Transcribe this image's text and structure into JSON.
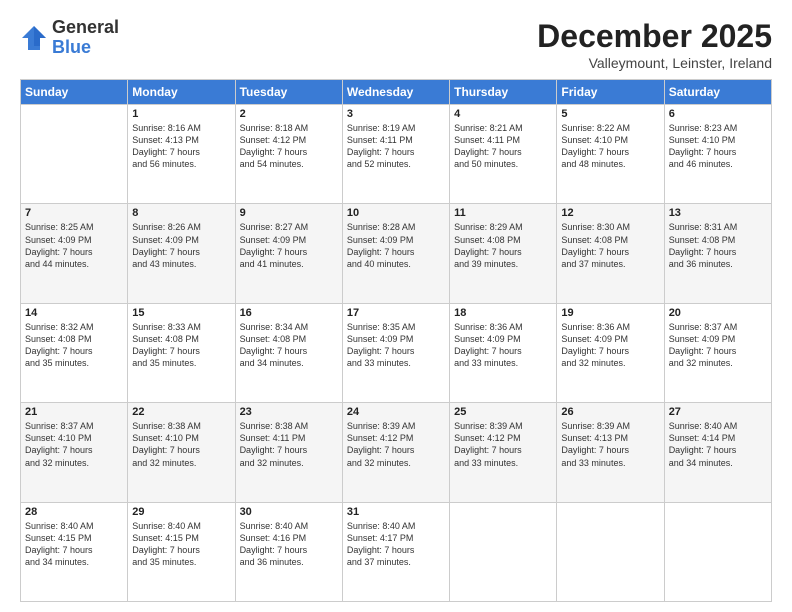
{
  "logo": {
    "general": "General",
    "blue": "Blue"
  },
  "title": {
    "month": "December 2025",
    "location": "Valleymount, Leinster, Ireland"
  },
  "headers": [
    "Sunday",
    "Monday",
    "Tuesday",
    "Wednesday",
    "Thursday",
    "Friday",
    "Saturday"
  ],
  "weeks": [
    [
      {
        "day": "",
        "info": ""
      },
      {
        "day": "1",
        "info": "Sunrise: 8:16 AM\nSunset: 4:13 PM\nDaylight: 7 hours\nand 56 minutes."
      },
      {
        "day": "2",
        "info": "Sunrise: 8:18 AM\nSunset: 4:12 PM\nDaylight: 7 hours\nand 54 minutes."
      },
      {
        "day": "3",
        "info": "Sunrise: 8:19 AM\nSunset: 4:11 PM\nDaylight: 7 hours\nand 52 minutes."
      },
      {
        "day": "4",
        "info": "Sunrise: 8:21 AM\nSunset: 4:11 PM\nDaylight: 7 hours\nand 50 minutes."
      },
      {
        "day": "5",
        "info": "Sunrise: 8:22 AM\nSunset: 4:10 PM\nDaylight: 7 hours\nand 48 minutes."
      },
      {
        "day": "6",
        "info": "Sunrise: 8:23 AM\nSunset: 4:10 PM\nDaylight: 7 hours\nand 46 minutes."
      }
    ],
    [
      {
        "day": "7",
        "info": "Sunrise: 8:25 AM\nSunset: 4:09 PM\nDaylight: 7 hours\nand 44 minutes."
      },
      {
        "day": "8",
        "info": "Sunrise: 8:26 AM\nSunset: 4:09 PM\nDaylight: 7 hours\nand 43 minutes."
      },
      {
        "day": "9",
        "info": "Sunrise: 8:27 AM\nSunset: 4:09 PM\nDaylight: 7 hours\nand 41 minutes."
      },
      {
        "day": "10",
        "info": "Sunrise: 8:28 AM\nSunset: 4:09 PM\nDaylight: 7 hours\nand 40 minutes."
      },
      {
        "day": "11",
        "info": "Sunrise: 8:29 AM\nSunset: 4:08 PM\nDaylight: 7 hours\nand 39 minutes."
      },
      {
        "day": "12",
        "info": "Sunrise: 8:30 AM\nSunset: 4:08 PM\nDaylight: 7 hours\nand 37 minutes."
      },
      {
        "day": "13",
        "info": "Sunrise: 8:31 AM\nSunset: 4:08 PM\nDaylight: 7 hours\nand 36 minutes."
      }
    ],
    [
      {
        "day": "14",
        "info": "Sunrise: 8:32 AM\nSunset: 4:08 PM\nDaylight: 7 hours\nand 35 minutes."
      },
      {
        "day": "15",
        "info": "Sunrise: 8:33 AM\nSunset: 4:08 PM\nDaylight: 7 hours\nand 35 minutes."
      },
      {
        "day": "16",
        "info": "Sunrise: 8:34 AM\nSunset: 4:08 PM\nDaylight: 7 hours\nand 34 minutes."
      },
      {
        "day": "17",
        "info": "Sunrise: 8:35 AM\nSunset: 4:09 PM\nDaylight: 7 hours\nand 33 minutes."
      },
      {
        "day": "18",
        "info": "Sunrise: 8:36 AM\nSunset: 4:09 PM\nDaylight: 7 hours\nand 33 minutes."
      },
      {
        "day": "19",
        "info": "Sunrise: 8:36 AM\nSunset: 4:09 PM\nDaylight: 7 hours\nand 32 minutes."
      },
      {
        "day": "20",
        "info": "Sunrise: 8:37 AM\nSunset: 4:09 PM\nDaylight: 7 hours\nand 32 minutes."
      }
    ],
    [
      {
        "day": "21",
        "info": "Sunrise: 8:37 AM\nSunset: 4:10 PM\nDaylight: 7 hours\nand 32 minutes."
      },
      {
        "day": "22",
        "info": "Sunrise: 8:38 AM\nSunset: 4:10 PM\nDaylight: 7 hours\nand 32 minutes."
      },
      {
        "day": "23",
        "info": "Sunrise: 8:38 AM\nSunset: 4:11 PM\nDaylight: 7 hours\nand 32 minutes."
      },
      {
        "day": "24",
        "info": "Sunrise: 8:39 AM\nSunset: 4:12 PM\nDaylight: 7 hours\nand 32 minutes."
      },
      {
        "day": "25",
        "info": "Sunrise: 8:39 AM\nSunset: 4:12 PM\nDaylight: 7 hours\nand 33 minutes."
      },
      {
        "day": "26",
        "info": "Sunrise: 8:39 AM\nSunset: 4:13 PM\nDaylight: 7 hours\nand 33 minutes."
      },
      {
        "day": "27",
        "info": "Sunrise: 8:40 AM\nSunset: 4:14 PM\nDaylight: 7 hours\nand 34 minutes."
      }
    ],
    [
      {
        "day": "28",
        "info": "Sunrise: 8:40 AM\nSunset: 4:15 PM\nDaylight: 7 hours\nand 34 minutes."
      },
      {
        "day": "29",
        "info": "Sunrise: 8:40 AM\nSunset: 4:15 PM\nDaylight: 7 hours\nand 35 minutes."
      },
      {
        "day": "30",
        "info": "Sunrise: 8:40 AM\nSunset: 4:16 PM\nDaylight: 7 hours\nand 36 minutes."
      },
      {
        "day": "31",
        "info": "Sunrise: 8:40 AM\nSunset: 4:17 PM\nDaylight: 7 hours\nand 37 minutes."
      },
      {
        "day": "",
        "info": ""
      },
      {
        "day": "",
        "info": ""
      },
      {
        "day": "",
        "info": ""
      }
    ]
  ]
}
